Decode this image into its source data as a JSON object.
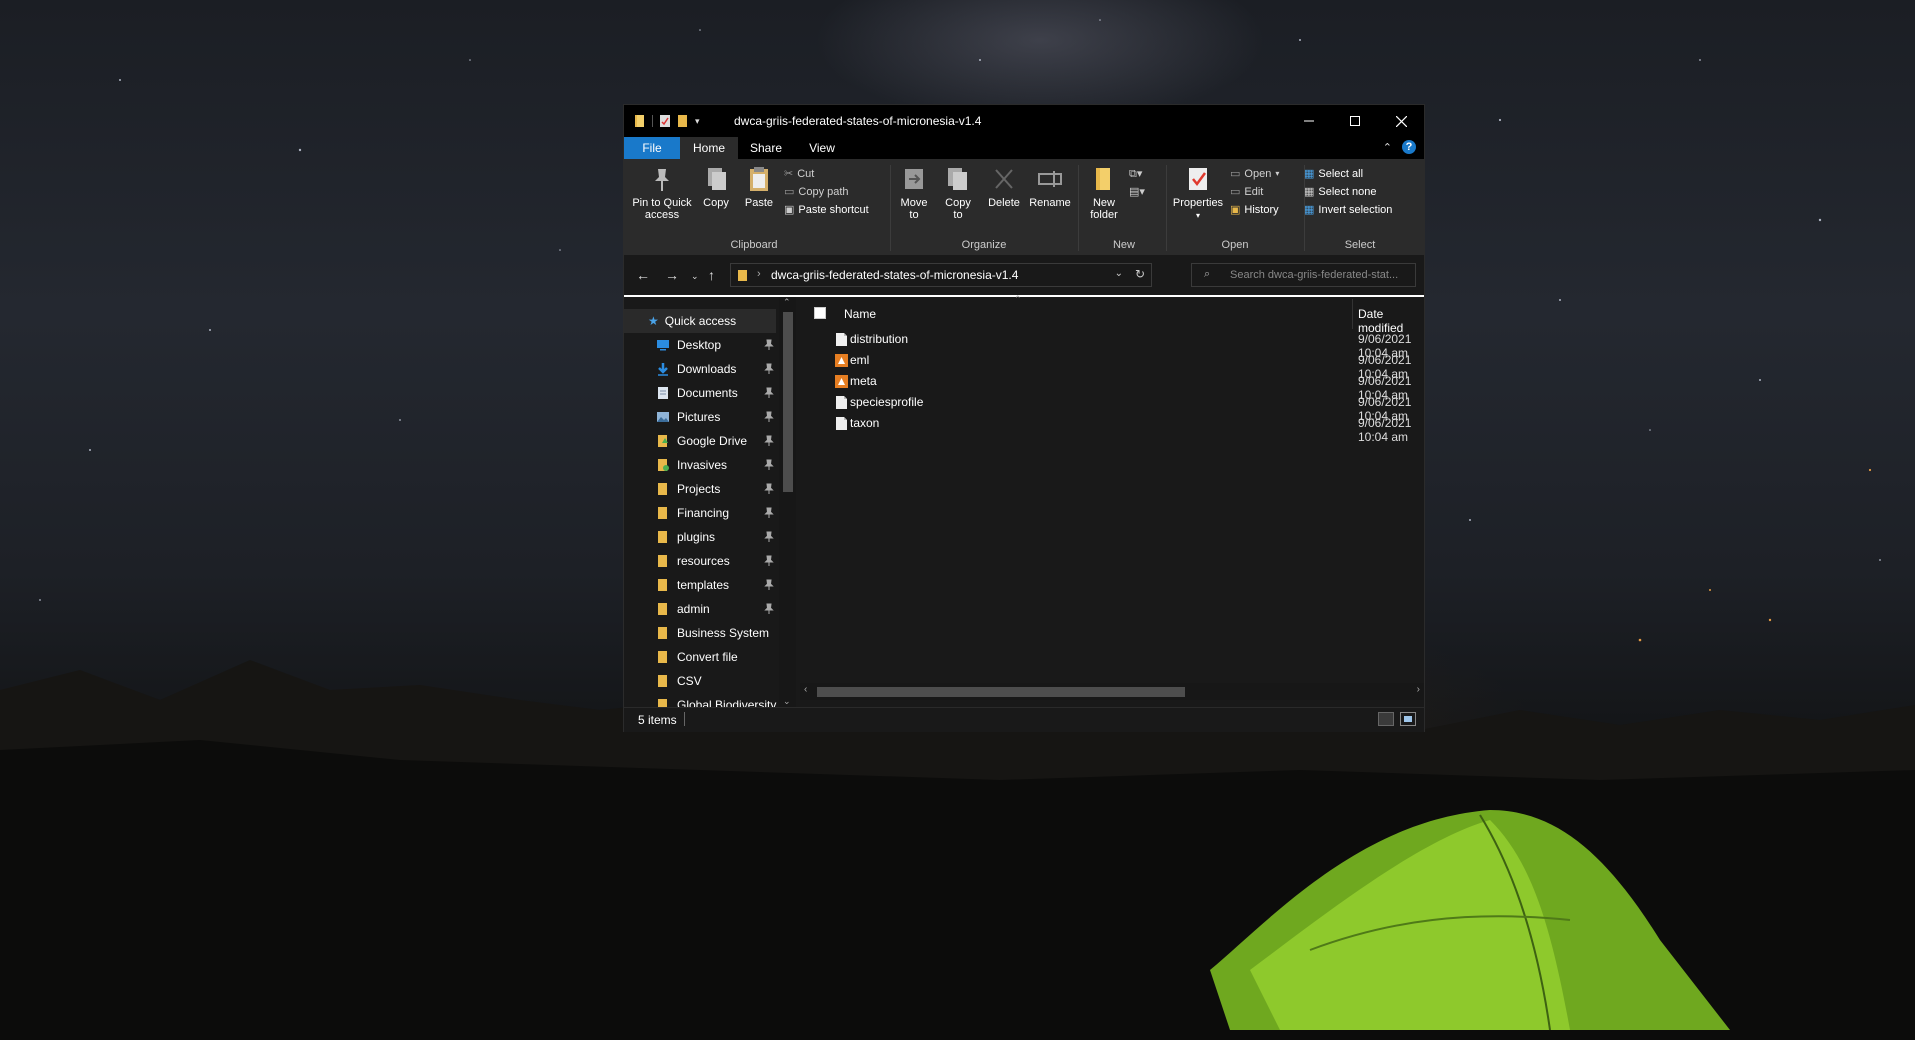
{
  "window": {
    "title": "dwca-griis-federated-states-of-micronesia-v1.4"
  },
  "ribbon_tabs": [
    "File",
    "Home",
    "Share",
    "View"
  ],
  "ribbon": {
    "clipboard": {
      "label": "Clipboard",
      "pin": [
        "Pin to Quick",
        "access"
      ],
      "copy": "Copy",
      "paste": "Paste",
      "cut": "Cut",
      "copy_path": "Copy path",
      "paste_shortcut": "Paste shortcut"
    },
    "organize": {
      "label": "Organize",
      "move_to": [
        "Move",
        "to"
      ],
      "copy_to": [
        "Copy",
        "to"
      ],
      "delete": "Delete",
      "rename": "Rename"
    },
    "new": {
      "label": "New",
      "new_folder": [
        "New",
        "folder"
      ]
    },
    "open": {
      "label": "Open",
      "properties": "Properties",
      "open": "Open",
      "edit": "Edit",
      "history": "History"
    },
    "select": {
      "label": "Select",
      "select_all": "Select all",
      "select_none": "Select none",
      "invert": "Invert selection"
    }
  },
  "address": {
    "path": "dwca-griis-federated-states-of-micronesia-v1.4",
    "search_placeholder": "Search dwca-griis-federated-stat..."
  },
  "nav": {
    "quick_access": "Quick access",
    "items": [
      {
        "label": "Desktop",
        "pinned": true,
        "icon": "desktop-icon"
      },
      {
        "label": "Downloads",
        "pinned": true,
        "icon": "downloads-icon"
      },
      {
        "label": "Documents",
        "pinned": true,
        "icon": "documents-icon"
      },
      {
        "label": "Pictures",
        "pinned": true,
        "icon": "pictures-icon"
      },
      {
        "label": "Google Drive",
        "pinned": true,
        "icon": "folder-icon"
      },
      {
        "label": "Invasives",
        "pinned": true,
        "icon": "folder-icon"
      },
      {
        "label": "Projects",
        "pinned": true,
        "icon": "folder-icon"
      },
      {
        "label": "Financing",
        "pinned": true,
        "icon": "folder-icon"
      },
      {
        "label": "plugins",
        "pinned": true,
        "icon": "folder-icon"
      },
      {
        "label": "resources",
        "pinned": true,
        "icon": "folder-icon"
      },
      {
        "label": "templates",
        "pinned": true,
        "icon": "folder-icon"
      },
      {
        "label": "admin",
        "pinned": true,
        "icon": "folder-icon"
      },
      {
        "label": "Business System",
        "pinned": false,
        "icon": "folder-icon"
      },
      {
        "label": "Convert file",
        "pinned": false,
        "icon": "folder-icon"
      },
      {
        "label": "CSV",
        "pinned": false,
        "icon": "folder-icon"
      },
      {
        "label": "Global Biodiversity",
        "pinned": false,
        "icon": "folder-icon"
      }
    ]
  },
  "columns": {
    "name": "Name",
    "date": "Date modified"
  },
  "files": [
    {
      "name": "distribution",
      "date": "9/06/2021 10:04 am",
      "icon": "text-file-icon"
    },
    {
      "name": "eml",
      "date": "9/06/2021 10:04 am",
      "icon": "xml-file-icon"
    },
    {
      "name": "meta",
      "date": "9/06/2021 10:04 am",
      "icon": "xml-file-icon"
    },
    {
      "name": "speciesprofile",
      "date": "9/06/2021 10:04 am",
      "icon": "text-file-icon"
    },
    {
      "name": "taxon",
      "date": "9/06/2021 10:04 am",
      "icon": "text-file-icon"
    }
  ],
  "status": {
    "count": "5 items"
  }
}
